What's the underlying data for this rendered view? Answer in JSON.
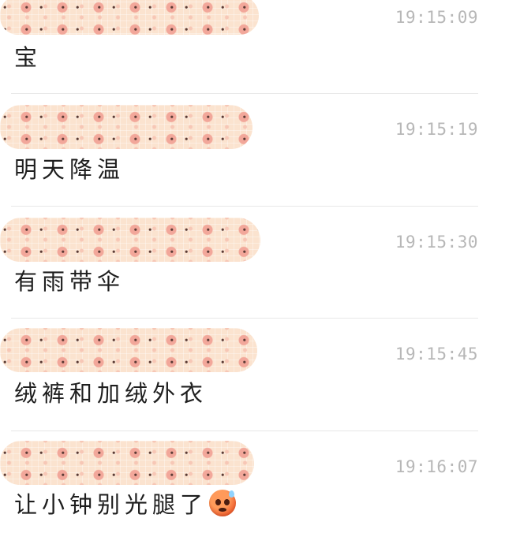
{
  "messages": [
    {
      "time": "19:15:09",
      "text": "宝",
      "emoji": null
    },
    {
      "time": "19:15:19",
      "text": "明天降温",
      "emoji": null
    },
    {
      "time": "19:15:30",
      "text": "有雨带伞",
      "emoji": null
    },
    {
      "time": "19:15:45",
      "text": "绒裤和加绒外衣",
      "emoji": null
    },
    {
      "time": "19:16:07",
      "text": "让小钟别光腿了",
      "emoji": "hot-face-sweat-emoji"
    }
  ],
  "colors": {
    "time": "#b7b7b7",
    "text": "#1e1e1e",
    "divider": "#e7e7e7",
    "sticker_bg": "#fbe3cf"
  }
}
